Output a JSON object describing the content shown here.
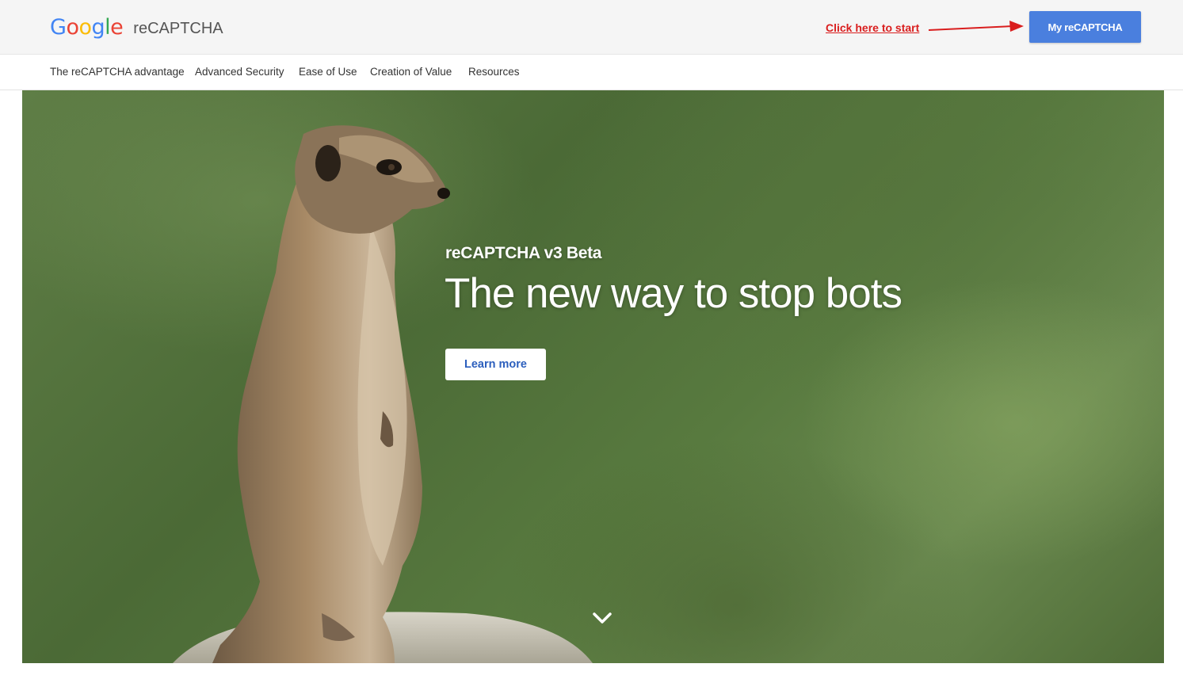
{
  "header": {
    "logo_google": [
      "G",
      "o",
      "o",
      "g",
      "l",
      "e"
    ],
    "logo_colors": [
      "#4285f4",
      "#ea4335",
      "#fbbc05",
      "#4285f4",
      "#34a853",
      "#ea4335"
    ],
    "product_name": "reCAPTCHA",
    "annotation": "Click here to start",
    "annotation_color": "#d91e1e",
    "cta_label": "My reCAPTCHA",
    "cta_color": "#4a7fde"
  },
  "nav": {
    "items": [
      {
        "label": "The reCAPTCHA advantage"
      },
      {
        "label": "Advanced Security"
      },
      {
        "label": "Ease of Use"
      },
      {
        "label": "Creation of Value"
      },
      {
        "label": "Resources"
      }
    ]
  },
  "hero": {
    "eyebrow": "reCAPTCHA v3 Beta",
    "title": "The new way to stop bots",
    "button_label": "Learn more",
    "scroll_icon": "chevron-down-icon",
    "image": "meerkat-photo"
  }
}
